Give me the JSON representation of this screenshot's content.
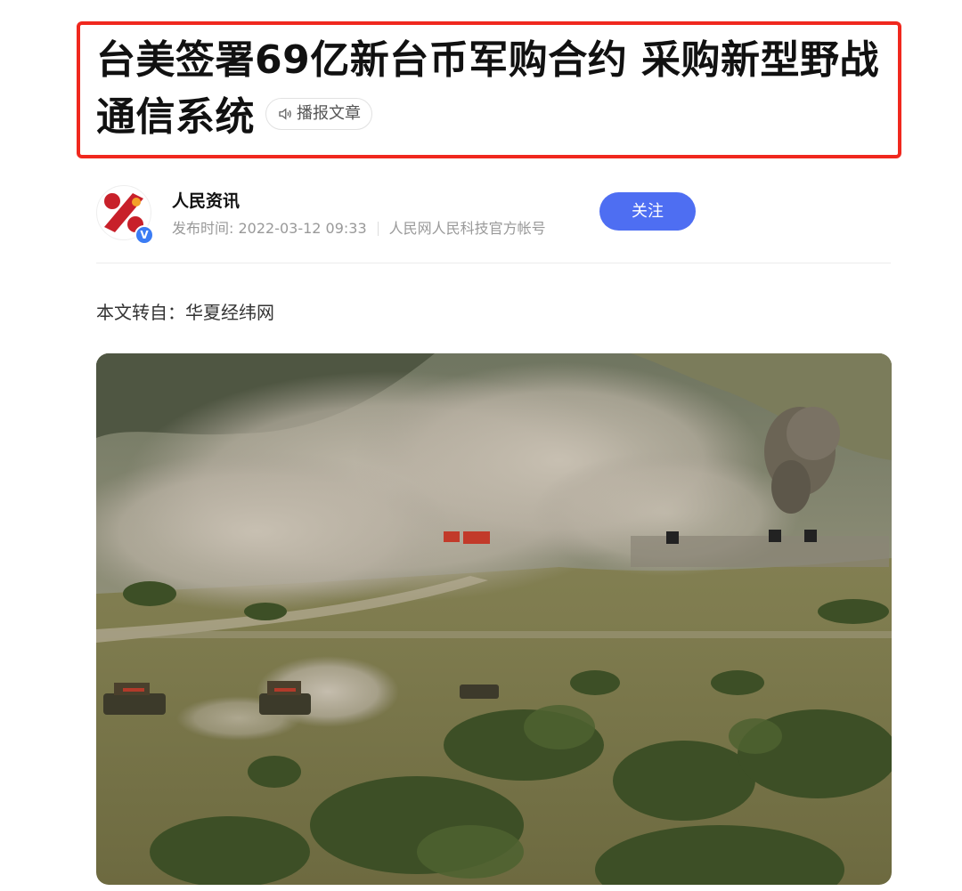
{
  "article": {
    "title": "台美签署69亿新台币军购合约 采购新型野战通信系统",
    "listen_label": "播报文章",
    "source_line": "本文转自：华夏经纬网"
  },
  "author": {
    "name": "人民资讯",
    "publish_label": "发布时间: 2022-03-12 09:33",
    "account_desc": "人民网人民科技官方帐号",
    "verified_mark": "V",
    "follow_label": "关注"
  },
  "colors": {
    "highlight_border": "#f0281e",
    "follow_button": "#4e6ef2",
    "verified_badge": "#3b7cf4"
  },
  "icons": [
    "speaker-icon",
    "verified-icon"
  ]
}
